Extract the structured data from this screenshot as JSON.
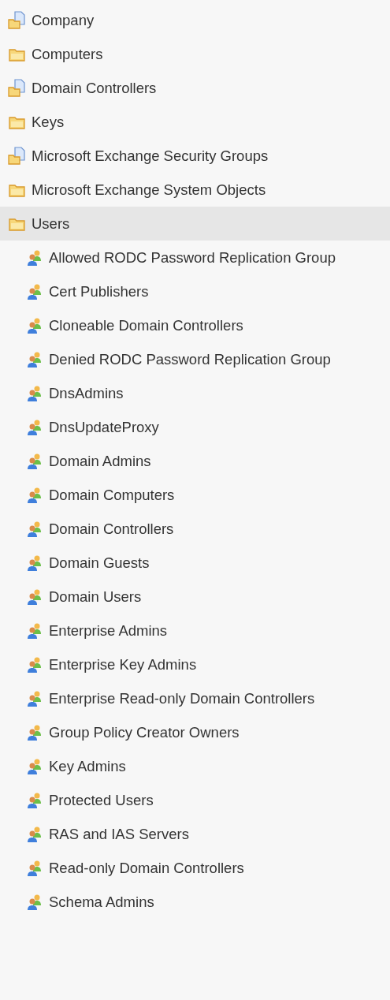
{
  "tree": [
    {
      "label": "Company",
      "kind": "unit",
      "selected": false
    },
    {
      "label": "Computers",
      "kind": "folder",
      "selected": false
    },
    {
      "label": "Domain Controllers",
      "kind": "unit",
      "selected": false
    },
    {
      "label": "Keys",
      "kind": "folder",
      "selected": false
    },
    {
      "label": "Microsoft Exchange Security Groups",
      "kind": "unit",
      "selected": false
    },
    {
      "label": "Microsoft Exchange System Objects",
      "kind": "folder",
      "selected": false
    },
    {
      "label": "Users",
      "kind": "folder",
      "selected": true,
      "children": [
        {
          "label": "Allowed RODC Password Replication Group",
          "kind": "group",
          "selected": false
        },
        {
          "label": "Cert Publishers",
          "kind": "group",
          "selected": false
        },
        {
          "label": "Cloneable Domain Controllers",
          "kind": "group",
          "selected": false
        },
        {
          "label": "Denied RODC Password Replication Group",
          "kind": "group",
          "selected": false
        },
        {
          "label": "DnsAdmins",
          "kind": "group",
          "selected": false
        },
        {
          "label": "DnsUpdateProxy",
          "kind": "group",
          "selected": false
        },
        {
          "label": "Domain Admins",
          "kind": "group",
          "selected": false
        },
        {
          "label": "Domain Computers",
          "kind": "group",
          "selected": false
        },
        {
          "label": "Domain Controllers",
          "kind": "group",
          "selected": false
        },
        {
          "label": "Domain Guests",
          "kind": "group",
          "selected": false
        },
        {
          "label": "Domain Users",
          "kind": "group",
          "selected": false
        },
        {
          "label": "Enterprise Admins",
          "kind": "group",
          "selected": false
        },
        {
          "label": "Enterprise Key Admins",
          "kind": "group",
          "selected": false
        },
        {
          "label": "Enterprise Read-only Domain Controllers",
          "kind": "group",
          "selected": false
        },
        {
          "label": "Group Policy Creator Owners",
          "kind": "group",
          "selected": false
        },
        {
          "label": "Key Admins",
          "kind": "group",
          "selected": false
        },
        {
          "label": "Protected Users",
          "kind": "group",
          "selected": false
        },
        {
          "label": "RAS and IAS Servers",
          "kind": "group",
          "selected": false
        },
        {
          "label": "Read-only Domain Controllers",
          "kind": "group",
          "selected": false
        },
        {
          "label": "Schema Admins",
          "kind": "group",
          "selected": false
        }
      ]
    }
  ]
}
